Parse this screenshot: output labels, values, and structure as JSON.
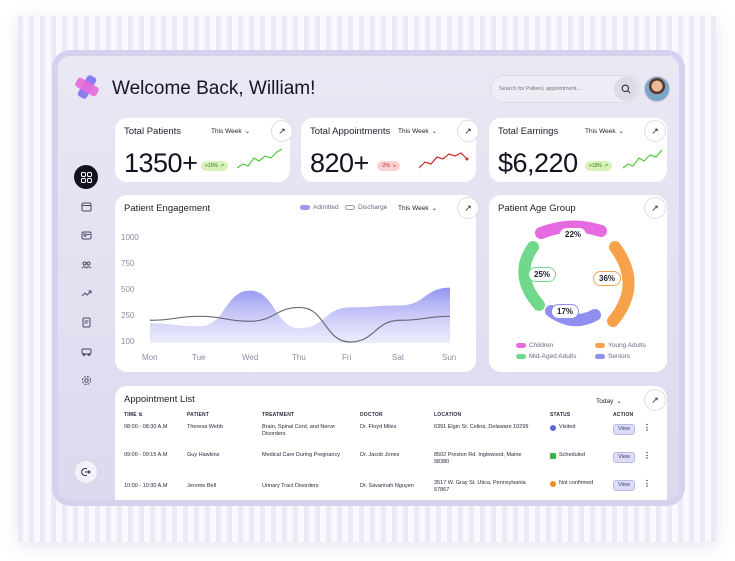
{
  "header": {
    "welcome": "Welcome Back, William!",
    "search_placeholder": "Search for Patient, appointment..."
  },
  "stats": [
    {
      "title": "Total Patients",
      "period": "This Week",
      "value": "1350+",
      "change": "+10%",
      "trend": "up"
    },
    {
      "title": "Total Appointments",
      "period": "This Week",
      "value": "820+",
      "change": "-2%",
      "trend": "down"
    },
    {
      "title": "Total Earnings",
      "period": "This Week",
      "value": "$6,220",
      "change": "+18%",
      "trend": "up"
    }
  ],
  "engagement": {
    "title": "Patient Engagement",
    "legend_admitted": "Admitted",
    "legend_discharge": "Discharge",
    "period": "This Week"
  },
  "chart_data": {
    "type": "area",
    "x": [
      "Mon",
      "Tue",
      "Wed",
      "Thu",
      "Fri",
      "Sat",
      "Sun"
    ],
    "yticks": [
      1000,
      750,
      500,
      250,
      100
    ],
    "ylim": [
      0,
      1000
    ],
    "series": [
      {
        "name": "Admitted",
        "type": "area",
        "values": [
          200,
          170,
          530,
          150,
          360,
          380,
          560
        ],
        "color": "#9a9af0"
      },
      {
        "name": "Discharge",
        "type": "line",
        "values": [
          230,
          270,
          220,
          360,
          10,
          230,
          270
        ],
        "color": "#6b6b7a"
      }
    ]
  },
  "age_group": {
    "title": "Patient Age Group",
    "segments": [
      {
        "label": "22%",
        "name": "Children",
        "color": "#e66be0"
      },
      {
        "label": "36%",
        "name": "Young Adults",
        "color": "#f7a14a"
      },
      {
        "label": "17%",
        "name": "Seniors",
        "color": "#8f8ff0"
      },
      {
        "label": "25%",
        "name": "Mid-Aged Adults",
        "color": "#6fd88b"
      }
    ]
  },
  "appointments": {
    "title": "Appointment List",
    "period": "Today",
    "columns": [
      "TIME",
      "PATIENT",
      "TREATMENT",
      "DOCTOR",
      "LOCATION",
      "STATUS",
      "ACTION"
    ],
    "rows": [
      {
        "time": "08:00 - 08:30 A.M",
        "patient": "Theresa Webb",
        "treatment": "Brain, Spinal Cord, and Nerve Disorders",
        "doctor": "Dr. Floyd Miles",
        "location": "6391 Elgin St. Celina, Delaware 10299",
        "status": "Visited",
        "status_color": "#5a67d8",
        "action": "View"
      },
      {
        "time": "09:00 - 09:15 A.M",
        "patient": "Guy Hawkins",
        "treatment": "Medical Care During Pregnancy",
        "doctor": "Dr. Jacob Jones",
        "location": "8502 Preston Rd. Inglewood, Maine 98380",
        "status": "Scheduled",
        "status_color": "#3bb54a",
        "action": "View"
      },
      {
        "time": "10:00 - 10:30 A.M",
        "patient": "Jerome Bell",
        "treatment": "Urinary Tract Disorders",
        "doctor": "Dr. Savannah Nguyen",
        "location": "3517 W. Gray St. Utica, Pennsylvania 57867",
        "status": "Not confirmed",
        "status_color": "#f08a24",
        "action": "View"
      }
    ]
  }
}
